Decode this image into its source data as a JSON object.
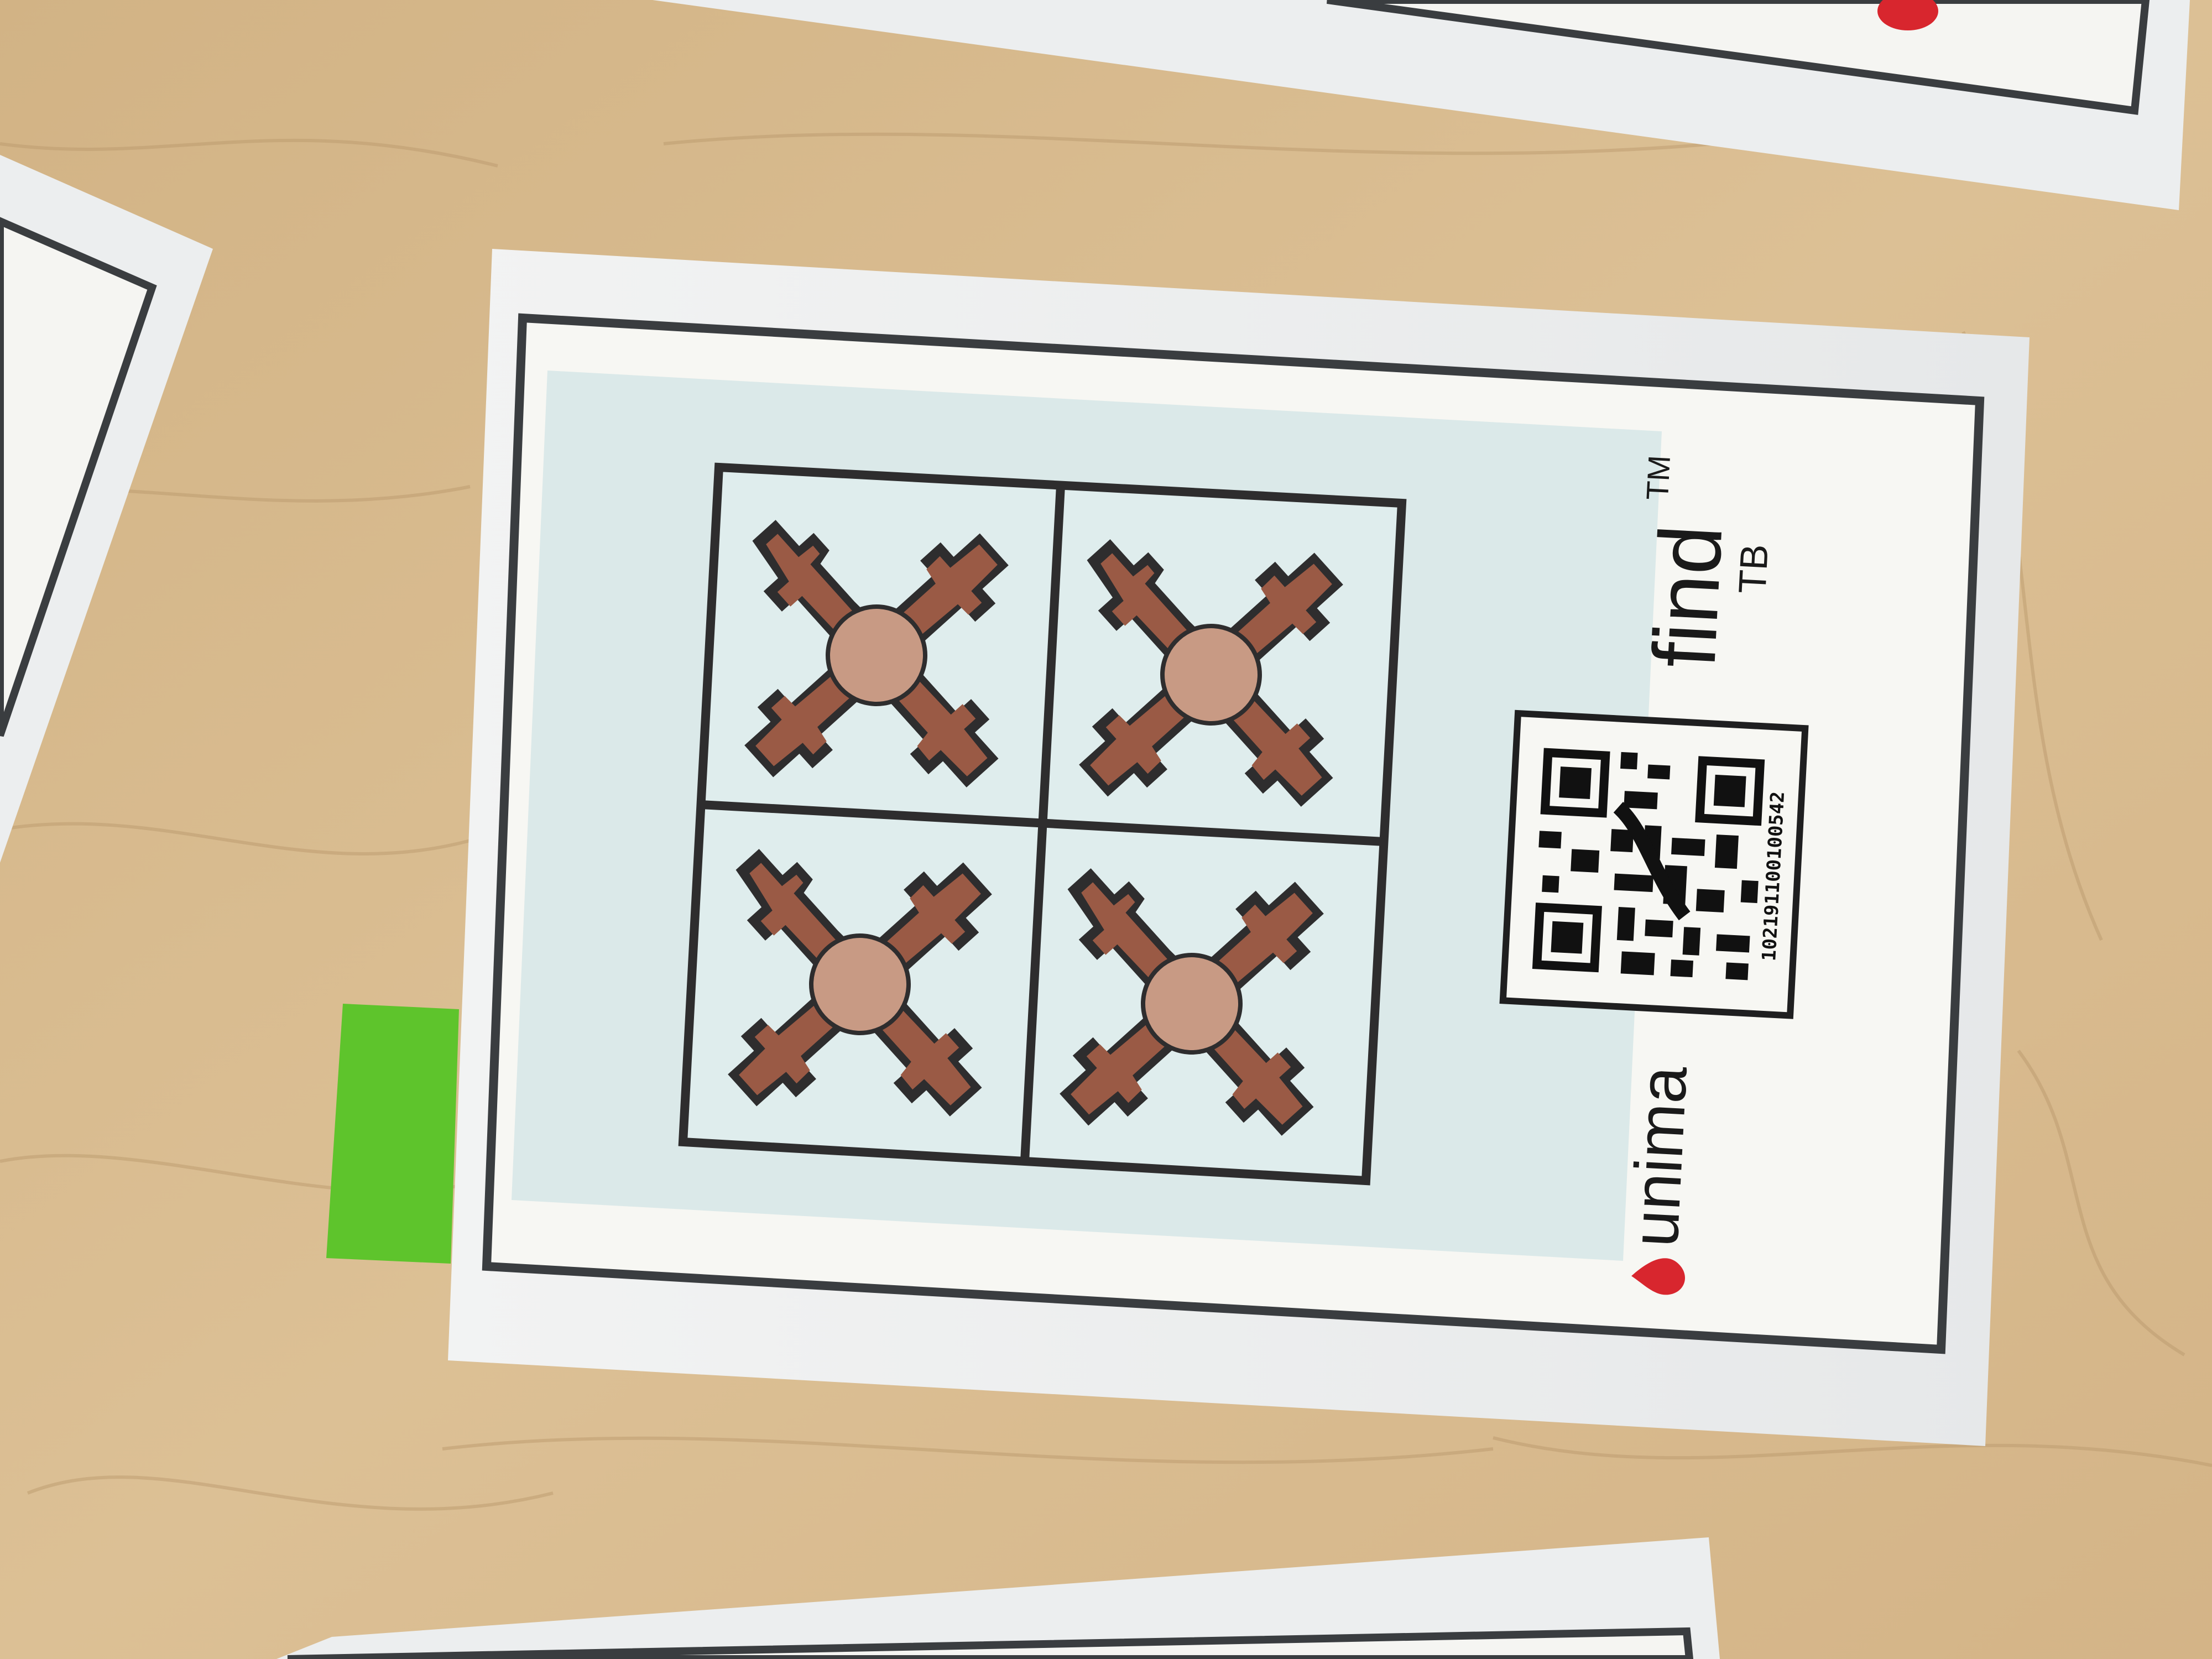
{
  "photo": {
    "subject": "paper test card on wooden table",
    "colors": {
      "table": "#d8bb90",
      "table_grain": "#b9966a",
      "card_backing": "#eef0f1",
      "card_face": "#f7f7f3",
      "panel_tint": "#d6e6e6",
      "border": "#3a3d40",
      "well_fill": "#9a5a45",
      "well_outline": "#2e2d2e",
      "spot_fill": "#c89a84",
      "tab_green": "#5ec42c",
      "brand_red": "#d8262e"
    }
  },
  "card": {
    "brand_find": "find",
    "brand_tm": "TM",
    "brand_sub": "TB",
    "brand_unima": "unima",
    "serial": "102191100100542",
    "qr_icon": "qr-code-icon",
    "drop_icon": "blood-drop-icon"
  }
}
